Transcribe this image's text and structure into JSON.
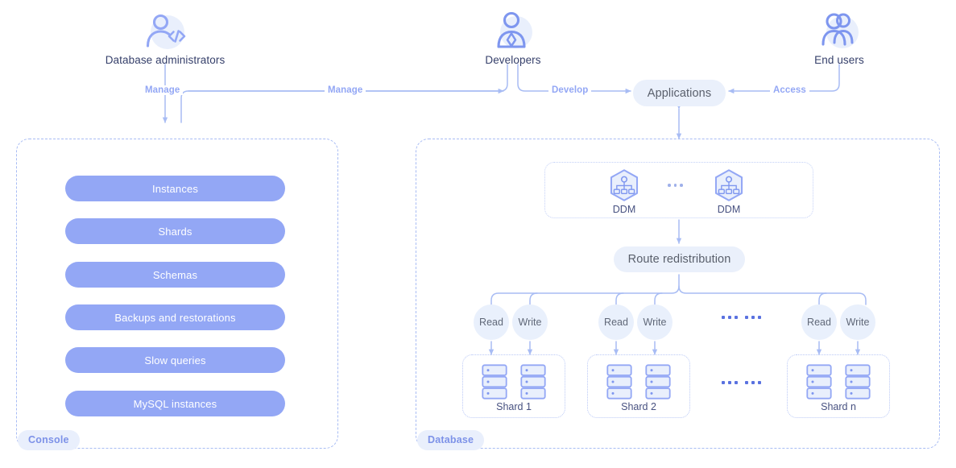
{
  "actors": [
    {
      "id": "dba",
      "label": "Database administrators",
      "icon": "user-code-icon"
    },
    {
      "id": "developers",
      "label": "Developers",
      "icon": "user-developer-icon"
    },
    {
      "id": "endusers",
      "label": "End users",
      "icon": "users-group-icon"
    }
  ],
  "edges": [
    {
      "id": "manage-left",
      "label": "Manage"
    },
    {
      "id": "manage-right",
      "label": "Manage"
    },
    {
      "id": "develop",
      "label": "Develop"
    },
    {
      "id": "access",
      "label": "Access"
    }
  ],
  "applications": {
    "label": "Applications"
  },
  "console": {
    "tag": "Console",
    "items": [
      {
        "label": "Instances"
      },
      {
        "label": "Shards"
      },
      {
        "label": "Schemas"
      },
      {
        "label": "Backups and restorations"
      },
      {
        "label": "Slow queries"
      },
      {
        "label": "MySQL instances"
      }
    ]
  },
  "database": {
    "tag": "Database",
    "ddm": {
      "nodes": [
        {
          "label": "DDM",
          "icon": "ddm-hexagon-icon"
        },
        {
          "label": "DDM",
          "icon": "ddm-hexagon-icon"
        }
      ],
      "ellipsis": "···"
    },
    "route": {
      "label": "Route redistribution"
    },
    "access_nodes": [
      {
        "read": "Read",
        "write": "Write"
      },
      {
        "read": "Read",
        "write": "Write"
      },
      {
        "read": "Read",
        "write": "Write"
      }
    ],
    "shards": [
      {
        "label": "Shard 1",
        "servers": 2
      },
      {
        "label": "Shard 2",
        "servers": 2
      },
      {
        "label": "Shard n",
        "servers": 2
      }
    ],
    "ellipsis_row": "··· ···"
  },
  "colors": {
    "pill_blue": "#93a7f5",
    "soft_blue": "#eaf0fb",
    "line_blue": "#a8bcf4",
    "dash_border": "#a8bcf4",
    "tag_text": "#7d92e8",
    "actor_text": "#36406b"
  }
}
